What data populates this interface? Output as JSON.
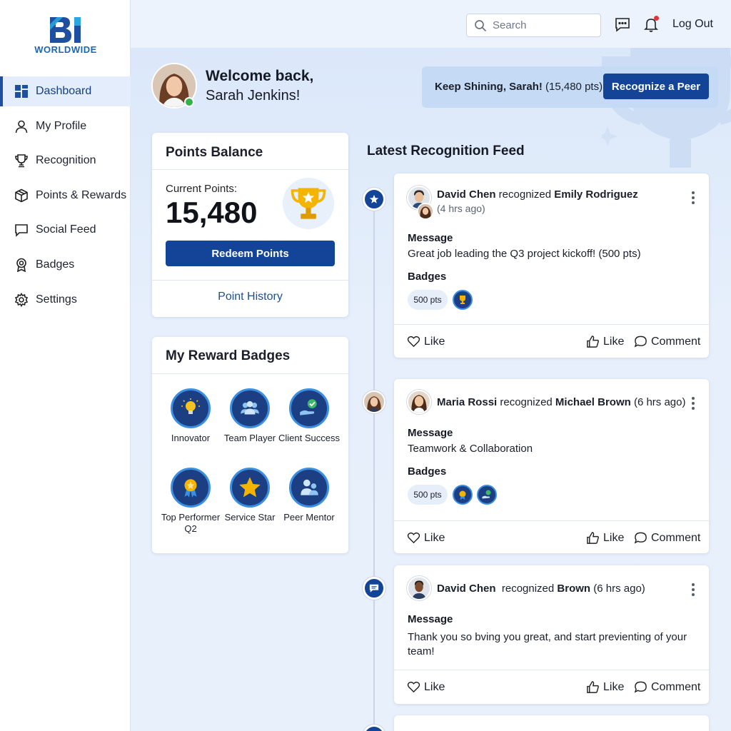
{
  "brand": {
    "logo_letters": "BI",
    "logo_text": "WORLDWIDE",
    "primary_color": "#134497",
    "accent_color": "#1d66b4"
  },
  "sidebar": {
    "items": [
      {
        "label": "Dashboard",
        "icon": "dashboard-icon",
        "active": true
      },
      {
        "label": "My Profile",
        "icon": "user-icon"
      },
      {
        "label": "Recognition",
        "icon": "trophy-icon"
      },
      {
        "label": "Points & Rewards",
        "icon": "box-icon"
      },
      {
        "label": "Social Feed",
        "icon": "chat-icon"
      },
      {
        "label": "Badges",
        "icon": "award-icon"
      },
      {
        "label": "Settings",
        "icon": "gear-icon"
      }
    ]
  },
  "topbar": {
    "search_placeholder": "Search",
    "logout_label": "Log Out"
  },
  "welcome": {
    "line1": "Welcome back,",
    "line2": "Sarah Jenkins!"
  },
  "banner": {
    "text_bold": "Keep Shining, Sarah!",
    "text_rest": " (15,480 pts)",
    "button_label": "Recognize a Peer"
  },
  "points_card": {
    "title": "Points Balance",
    "current_label": "Current Points:",
    "current_value": "15,480",
    "redeem_label": "Redeem Points",
    "history_label": "Point History"
  },
  "badges_card": {
    "title": "My Reward Badges",
    "badges": [
      {
        "label": "Innovator",
        "icon": "lightbulb-icon"
      },
      {
        "label": "Team Player",
        "icon": "team-icon"
      },
      {
        "label": "Client Success",
        "icon": "handshake-check-icon"
      },
      {
        "label": "Top Performer Q2",
        "icon": "ribbon-icon"
      },
      {
        "label": "Service Star",
        "icon": "star-icon"
      },
      {
        "label": "Peer Mentor",
        "icon": "mentor-icon"
      }
    ]
  },
  "feed": {
    "title": "Latest Recognition Feed",
    "posts": [
      {
        "giver": "David Chen",
        "verb": " recognized ",
        "receiver": "Emily Rodriguez",
        "time": "(4 hrs ago)",
        "message_label": "Message",
        "message": "Great job leading the Q3 project kickoff! (500 pts)",
        "badges_label": "Badges",
        "points_pill": "500 pts",
        "like_left": "Like",
        "like_right": "Like",
        "comment": "Comment"
      },
      {
        "giver": "Maria Rossi",
        "verb": " recognized ",
        "receiver": "Michael Brown",
        "time": " (6 hrs ago)",
        "message_label": "Message",
        "message": "Teamwork & Collaboration",
        "badges_label": "Badges",
        "points_pill": "500 pts",
        "like_left": "Like",
        "like_right": "Like",
        "comment": "Comment"
      },
      {
        "giver": "David Chen",
        "verb": "  recognized ",
        "receiver": "Brown",
        "time": " (6 hrs ago)",
        "message_label": "Message",
        "message": "Thank you so bving you great, and start previenting of your team!",
        "like_left": "Like",
        "like_right": "Like",
        "comment": "Comment"
      }
    ]
  }
}
